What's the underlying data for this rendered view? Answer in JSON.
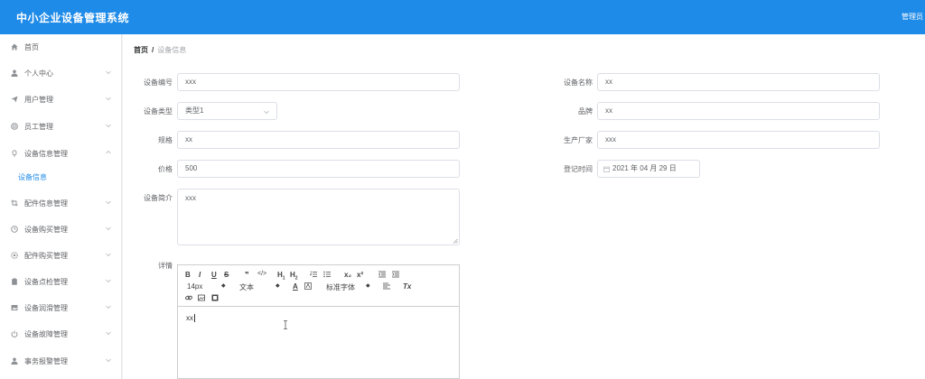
{
  "header": {
    "title": "中小企业设备管理系统",
    "user": "管理员"
  },
  "sidebar": {
    "items": [
      {
        "label": "首页",
        "icon": "home-icon"
      },
      {
        "label": "个人中心",
        "icon": "user-icon"
      },
      {
        "label": "用户管理",
        "icon": "send-icon"
      },
      {
        "label": "员工管理",
        "icon": "lifebuoy-icon"
      },
      {
        "label": "设备信息管理",
        "icon": "lock-icon"
      },
      {
        "label": "设备信息",
        "icon": ""
      },
      {
        "label": "配件信息管理",
        "icon": "crop-icon"
      },
      {
        "label": "设备购买管理",
        "icon": "clock-icon"
      },
      {
        "label": "配件购买管理",
        "icon": "gear-icon"
      },
      {
        "label": "设备点检管理",
        "icon": "clipboard-icon"
      },
      {
        "label": "设备润滑管理",
        "icon": "picture-icon"
      },
      {
        "label": "设备故障管理",
        "icon": "power-icon"
      },
      {
        "label": "事务报警管理",
        "icon": "person-icon"
      }
    ]
  },
  "breadcrumb": {
    "home": "首页",
    "sep": "/",
    "current": "设备信息"
  },
  "form": {
    "device_no": {
      "label": "设备编号",
      "value": "xxx"
    },
    "device_name": {
      "label": "设备名称",
      "value": "xx"
    },
    "device_type": {
      "label": "设备类型",
      "value": "类型1"
    },
    "brand": {
      "label": "品牌",
      "value": "xx"
    },
    "spec": {
      "label": "规格",
      "value": "xx"
    },
    "maker": {
      "label": "生产厂家",
      "value": "xxx"
    },
    "price": {
      "label": "价格",
      "value": "500"
    },
    "reg_time": {
      "label": "登记时间",
      "value": "2021 年 04 月 29 日"
    },
    "intro": {
      "label": "设备简介",
      "value": "xxx"
    },
    "detail": {
      "label": "详情",
      "value": "xx"
    }
  },
  "editor": {
    "font_size": "14px",
    "block_type": "文本",
    "font_family": "标准字体",
    "buttons": [
      "B",
      "I",
      "U",
      "S",
      "❞",
      "</>",
      "H1",
      "H2",
      "ol",
      "ul",
      "x₂",
      "x²",
      "outdent",
      "indent",
      "A",
      "bg",
      "align",
      "Tx",
      "link",
      "image",
      "video"
    ]
  },
  "colors": {
    "primary": "#1f8be8",
    "sidebar_bg": "#ffffff",
    "border": "#dcdfe6"
  }
}
